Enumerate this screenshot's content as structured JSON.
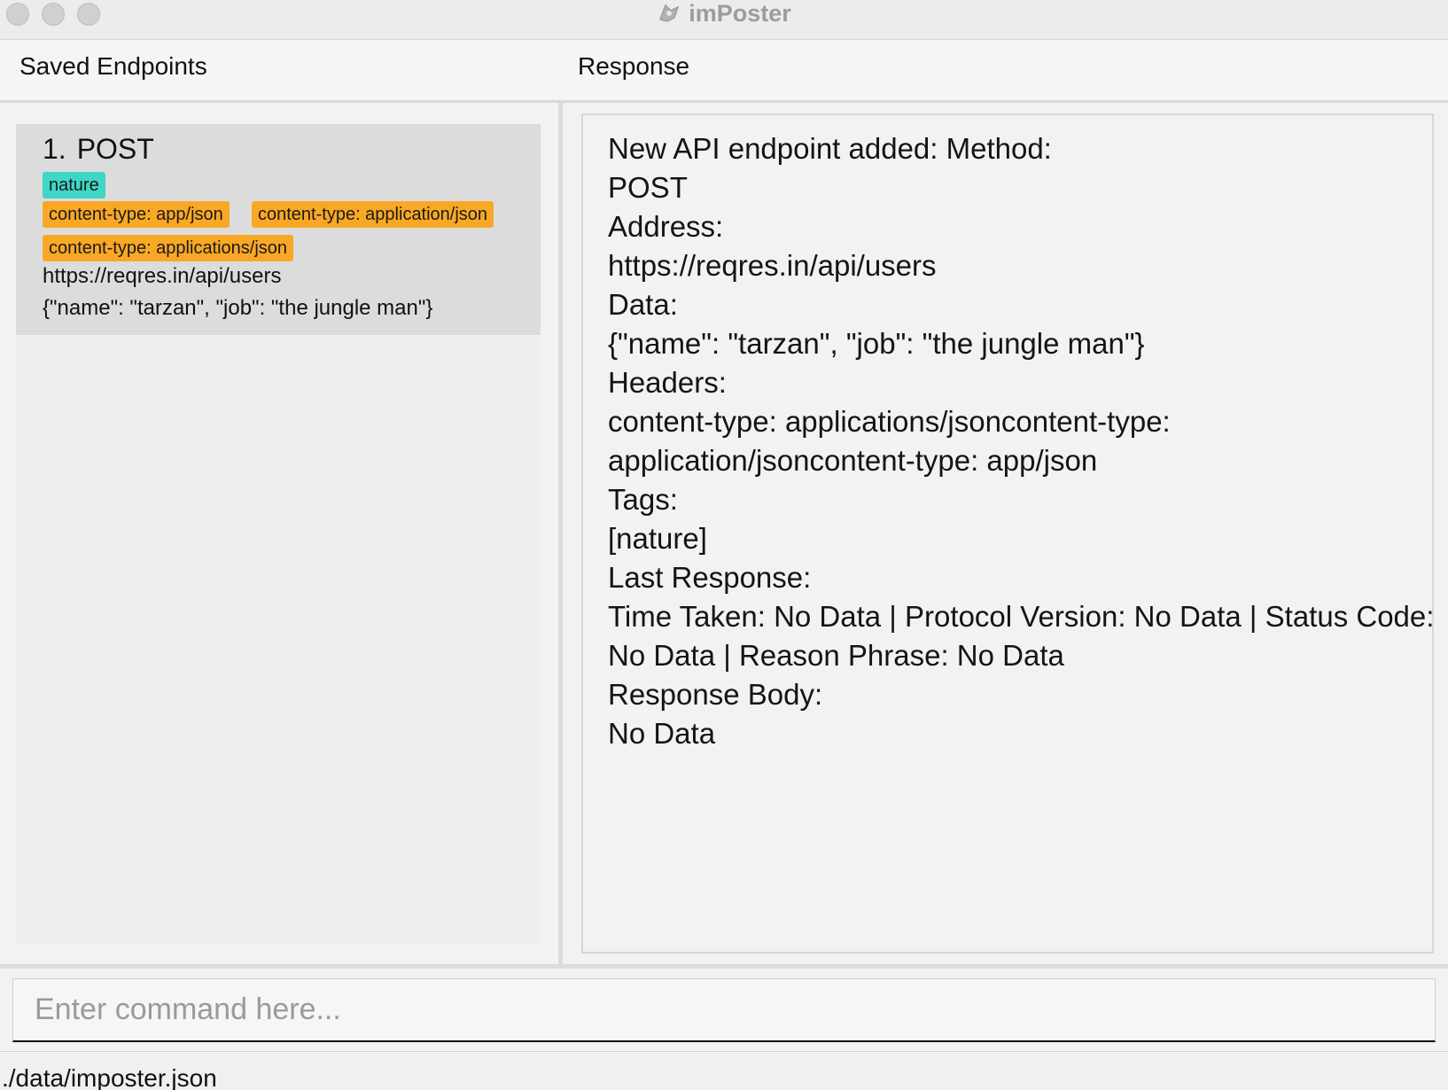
{
  "window": {
    "title": "imPoster",
    "logo_icon": "imposter-logo-icon"
  },
  "left_panel": {
    "header": "Saved Endpoints",
    "endpoints": [
      {
        "index": "1.",
        "method": "POST",
        "tags": [
          {
            "label": "nature",
            "color": "#3fd6c6"
          }
        ],
        "headers": [
          {
            "label": "content-type: app/json",
            "color": "#f9a825"
          },
          {
            "label": "content-type: application/json",
            "color": "#f9a825"
          },
          {
            "label": "content-type: applications/json",
            "color": "#f9a825"
          }
        ],
        "url": "https://reqres.in/api/users",
        "data": "{\"name\": \"tarzan\", \"job\": \"the jungle man\"}"
      }
    ]
  },
  "right_panel": {
    "header": "Response",
    "lines": [
      "New API endpoint added: Method:",
      "POST",
      "Address:",
      "https://reqres.in/api/users",
      "Data:",
      "{\"name\": \"tarzan\", \"job\": \"the jungle man\"}",
      "Headers:",
      "content-type: applications/jsoncontent-type:",
      "application/jsoncontent-type: app/json",
      "Tags:",
      "[nature]",
      "Last Response:",
      "Time Taken: No Data | Protocol Version: No Data | Status Code:",
      "No Data | Reason Phrase: No Data",
      "Response Body:",
      "No Data"
    ]
  },
  "command": {
    "placeholder": "Enter command here...",
    "value": ""
  },
  "status_bar": {
    "file_path": "./data/imposter.json"
  }
}
